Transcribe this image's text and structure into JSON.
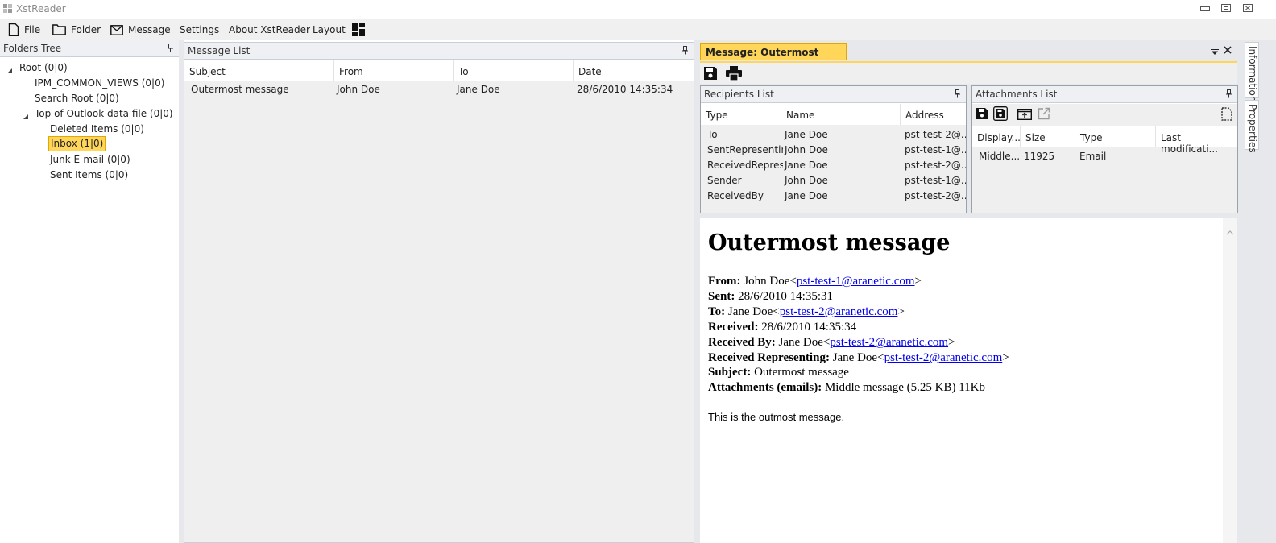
{
  "app": {
    "title": "XstReader"
  },
  "menu": {
    "file": "File",
    "folder": "Folder",
    "message": "Message",
    "settings": "Settings",
    "about": "About XstReader",
    "layout": "Layout"
  },
  "folders": {
    "title": "Folders Tree",
    "nodes": [
      {
        "label": "Root (0|0)"
      },
      {
        "label": "IPM_COMMON_VIEWS (0|0)"
      },
      {
        "label": "Search Root (0|0)"
      },
      {
        "label": "Top of Outlook data file (0|0)"
      },
      {
        "label": "Deleted Items (0|0)"
      },
      {
        "label": "Inbox (1|0)"
      },
      {
        "label": "Junk E-mail (0|0)"
      },
      {
        "label": "Sent Items (0|0)"
      }
    ]
  },
  "message_list": {
    "title": "Message List",
    "columns": [
      "Subject",
      "From",
      "To",
      "Date"
    ],
    "rows": [
      {
        "subject": "Outermost message",
        "from": "John Doe",
        "to": "Jane Doe",
        "date": "28/6/2010 14:35:34"
      }
    ]
  },
  "message_tab": {
    "label": "Message: Outermost message"
  },
  "recipients": {
    "title": "Recipients List",
    "columns": [
      "Type",
      "Name",
      "Address"
    ],
    "rows": [
      {
        "type": "To",
        "name": "Jane Doe",
        "address": "pst-test-2@..."
      },
      {
        "type": "SentRepresenting",
        "name": "John Doe",
        "address": "pst-test-1@..."
      },
      {
        "type": "ReceivedRepres...",
        "name": "Jane Doe",
        "address": "pst-test-2@..."
      },
      {
        "type": "Sender",
        "name": "John Doe",
        "address": "pst-test-1@..."
      },
      {
        "type": "ReceivedBy",
        "name": "Jane Doe",
        "address": "pst-test-2@..."
      }
    ]
  },
  "attachments": {
    "title": "Attachments List",
    "columns": [
      "Display...",
      "Size",
      "Type",
      "Last modificati..."
    ],
    "rows": [
      {
        "display": "Middle...",
        "size": "11925",
        "type": "Email",
        "modified": ""
      }
    ]
  },
  "preview": {
    "heading": "Outermost message",
    "from_label": "From:",
    "from_name": "John Doe",
    "from_email": "pst-test-1@aranetic.com",
    "sent_label": "Sent:",
    "sent_value": "28/6/2010 14:35:31",
    "to_label": "To:",
    "to_name": "Jane Doe",
    "to_email": "pst-test-2@aranetic.com",
    "received_label": "Received:",
    "received_value": "28/6/2010 14:35:34",
    "received_by_label": "Received By:",
    "received_by_name": "Jane Doe",
    "received_by_email": "pst-test-2@aranetic.com",
    "received_rep_label": "Received Representing:",
    "received_rep_name": "Jane Doe",
    "received_rep_email": "pst-test-2@aranetic.com",
    "subject_label": "Subject:",
    "subject_value": "Outermost message",
    "attachments_label": "Attachments (emails):",
    "attachments_value": "Middle message (5.25 KB) 11Kb",
    "body": "This is the outmost message."
  },
  "side_tabs": {
    "information": "Information",
    "properties": "Properties"
  },
  "colors": {
    "selection": "#ffd659",
    "selection_border": "#e3a800",
    "link": "#0000ee"
  }
}
